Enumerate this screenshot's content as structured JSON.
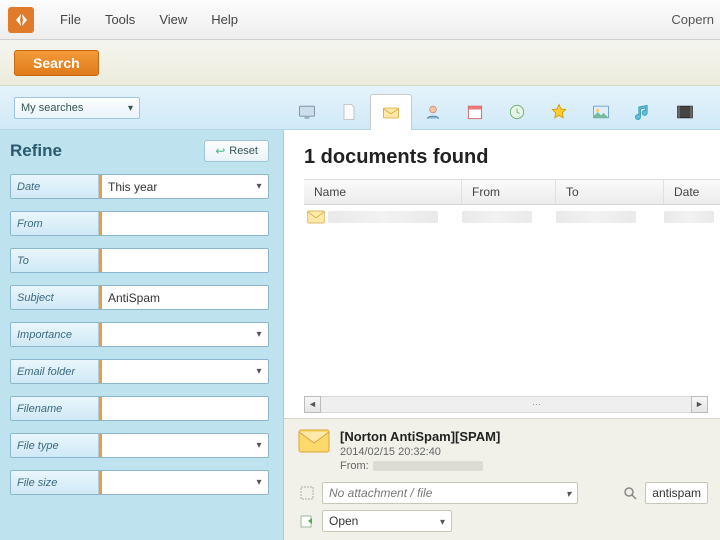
{
  "menubar": {
    "items": [
      "File",
      "Tools",
      "View",
      "Help"
    ],
    "brand": "Copern"
  },
  "search": {
    "button": "Search",
    "my_searches": "My searches"
  },
  "categories": [
    "desktop",
    "document",
    "email",
    "contact",
    "calendar",
    "history",
    "favorite",
    "picture",
    "music",
    "video"
  ],
  "active_category": 2,
  "refine": {
    "title": "Refine",
    "reset": "Reset",
    "rows": [
      {
        "label": "Date",
        "value": "This year",
        "dropdown": true
      },
      {
        "label": "From",
        "value": "",
        "dropdown": false
      },
      {
        "label": "To",
        "value": "",
        "dropdown": false
      },
      {
        "label": "Subject",
        "value": "AntiSpam",
        "dropdown": false
      },
      {
        "label": "Importance",
        "value": "",
        "dropdown": true
      },
      {
        "label": "Email folder",
        "value": "",
        "dropdown": true
      },
      {
        "label": "Filename",
        "value": "",
        "dropdown": false
      },
      {
        "label": "File type",
        "value": "",
        "dropdown": true
      },
      {
        "label": "File size",
        "value": "",
        "dropdown": true
      }
    ]
  },
  "results": {
    "heading": "1 documents found",
    "columns": [
      "Name",
      "From",
      "To",
      "Date"
    ]
  },
  "preview": {
    "subject": "[Norton AntiSpam][SPAM]",
    "datetime": "2014/02/15 20:32:40",
    "from_label": "From:",
    "attachment": "No attachment / file",
    "search_term": "antispam",
    "open": "Open"
  }
}
